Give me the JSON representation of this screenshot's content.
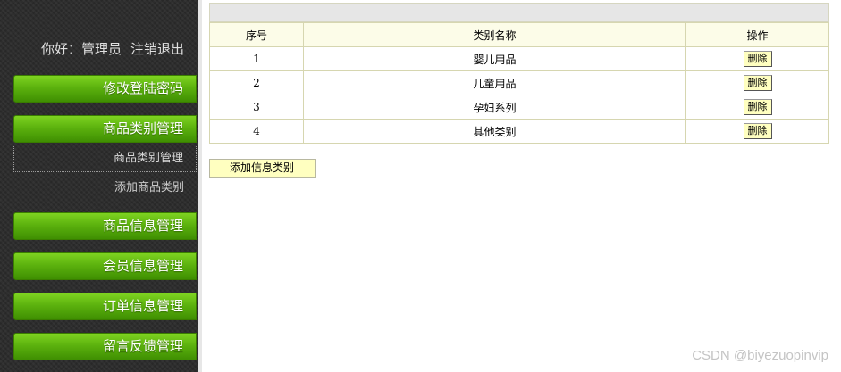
{
  "sidebar": {
    "greeting": "你好：管理员",
    "logout": "注销退出",
    "menu": {
      "change_password": "修改登陆密码",
      "category_mgmt": "商品类别管理",
      "sub_category_mgmt": "商品类别管理",
      "sub_add_category": "添加商品类别",
      "product_info": "商品信息管理",
      "member_info": "会员信息管理",
      "order_info": "订单信息管理",
      "feedback": "留言反馈管理"
    }
  },
  "table": {
    "headers": [
      "序号",
      "类别名称",
      "操作"
    ],
    "rows": [
      {
        "index": "1",
        "name": "婴儿用品",
        "action": "删除"
      },
      {
        "index": "2",
        "name": "儿童用品",
        "action": "删除"
      },
      {
        "index": "3",
        "name": "孕妇系列",
        "action": "删除"
      },
      {
        "index": "4",
        "name": "其他类别",
        "action": "删除"
      }
    ]
  },
  "add_button": "添加信息类别",
  "watermark": "CSDN @biyezuopinvip",
  "colors": {
    "menu_green": "#5cb20e",
    "table_border": "#d6d6b0",
    "button_yellow": "#ffffc0"
  }
}
